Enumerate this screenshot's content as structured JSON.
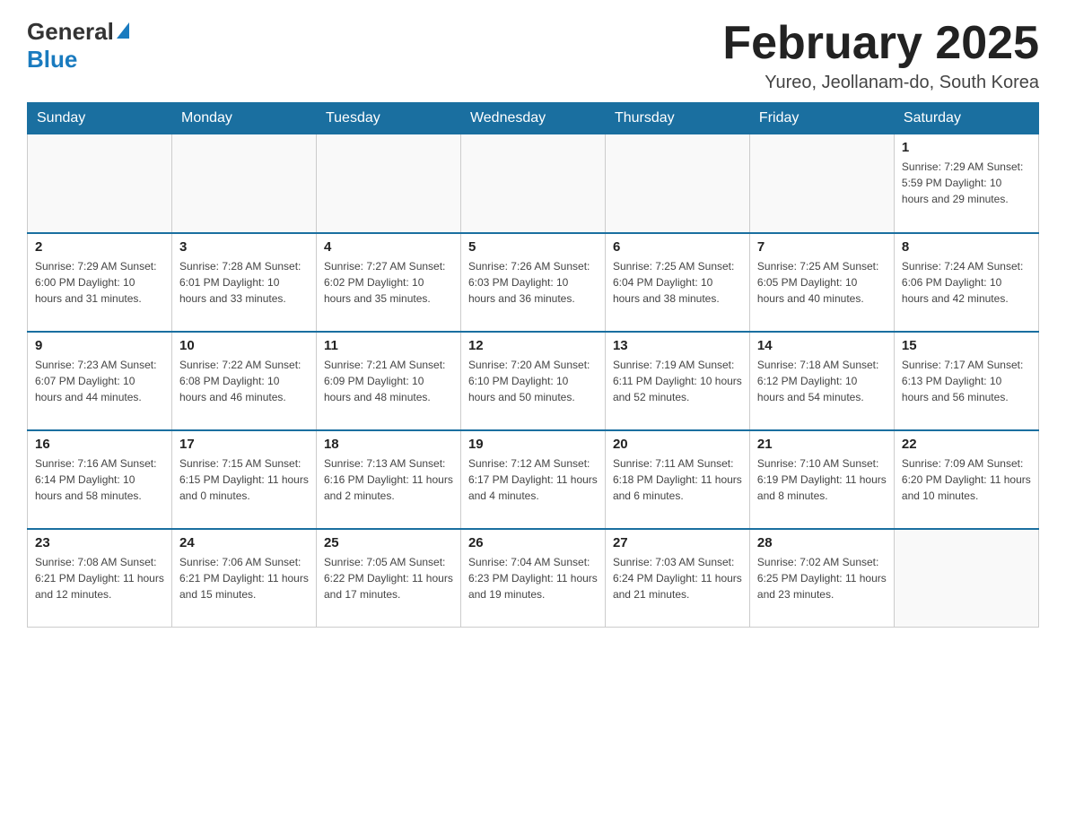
{
  "header": {
    "logo_general": "General",
    "logo_blue": "Blue",
    "month_title": "February 2025",
    "location": "Yureo, Jeollanam-do, South Korea"
  },
  "weekdays": [
    "Sunday",
    "Monday",
    "Tuesday",
    "Wednesday",
    "Thursday",
    "Friday",
    "Saturday"
  ],
  "weeks": [
    [
      {
        "day": "",
        "info": ""
      },
      {
        "day": "",
        "info": ""
      },
      {
        "day": "",
        "info": ""
      },
      {
        "day": "",
        "info": ""
      },
      {
        "day": "",
        "info": ""
      },
      {
        "day": "",
        "info": ""
      },
      {
        "day": "1",
        "info": "Sunrise: 7:29 AM\nSunset: 5:59 PM\nDaylight: 10 hours\nand 29 minutes."
      }
    ],
    [
      {
        "day": "2",
        "info": "Sunrise: 7:29 AM\nSunset: 6:00 PM\nDaylight: 10 hours\nand 31 minutes."
      },
      {
        "day": "3",
        "info": "Sunrise: 7:28 AM\nSunset: 6:01 PM\nDaylight: 10 hours\nand 33 minutes."
      },
      {
        "day": "4",
        "info": "Sunrise: 7:27 AM\nSunset: 6:02 PM\nDaylight: 10 hours\nand 35 minutes."
      },
      {
        "day": "5",
        "info": "Sunrise: 7:26 AM\nSunset: 6:03 PM\nDaylight: 10 hours\nand 36 minutes."
      },
      {
        "day": "6",
        "info": "Sunrise: 7:25 AM\nSunset: 6:04 PM\nDaylight: 10 hours\nand 38 minutes."
      },
      {
        "day": "7",
        "info": "Sunrise: 7:25 AM\nSunset: 6:05 PM\nDaylight: 10 hours\nand 40 minutes."
      },
      {
        "day": "8",
        "info": "Sunrise: 7:24 AM\nSunset: 6:06 PM\nDaylight: 10 hours\nand 42 minutes."
      }
    ],
    [
      {
        "day": "9",
        "info": "Sunrise: 7:23 AM\nSunset: 6:07 PM\nDaylight: 10 hours\nand 44 minutes."
      },
      {
        "day": "10",
        "info": "Sunrise: 7:22 AM\nSunset: 6:08 PM\nDaylight: 10 hours\nand 46 minutes."
      },
      {
        "day": "11",
        "info": "Sunrise: 7:21 AM\nSunset: 6:09 PM\nDaylight: 10 hours\nand 48 minutes."
      },
      {
        "day": "12",
        "info": "Sunrise: 7:20 AM\nSunset: 6:10 PM\nDaylight: 10 hours\nand 50 minutes."
      },
      {
        "day": "13",
        "info": "Sunrise: 7:19 AM\nSunset: 6:11 PM\nDaylight: 10 hours\nand 52 minutes."
      },
      {
        "day": "14",
        "info": "Sunrise: 7:18 AM\nSunset: 6:12 PM\nDaylight: 10 hours\nand 54 minutes."
      },
      {
        "day": "15",
        "info": "Sunrise: 7:17 AM\nSunset: 6:13 PM\nDaylight: 10 hours\nand 56 minutes."
      }
    ],
    [
      {
        "day": "16",
        "info": "Sunrise: 7:16 AM\nSunset: 6:14 PM\nDaylight: 10 hours\nand 58 minutes."
      },
      {
        "day": "17",
        "info": "Sunrise: 7:15 AM\nSunset: 6:15 PM\nDaylight: 11 hours\nand 0 minutes."
      },
      {
        "day": "18",
        "info": "Sunrise: 7:13 AM\nSunset: 6:16 PM\nDaylight: 11 hours\nand 2 minutes."
      },
      {
        "day": "19",
        "info": "Sunrise: 7:12 AM\nSunset: 6:17 PM\nDaylight: 11 hours\nand 4 minutes."
      },
      {
        "day": "20",
        "info": "Sunrise: 7:11 AM\nSunset: 6:18 PM\nDaylight: 11 hours\nand 6 minutes."
      },
      {
        "day": "21",
        "info": "Sunrise: 7:10 AM\nSunset: 6:19 PM\nDaylight: 11 hours\nand 8 minutes."
      },
      {
        "day": "22",
        "info": "Sunrise: 7:09 AM\nSunset: 6:20 PM\nDaylight: 11 hours\nand 10 minutes."
      }
    ],
    [
      {
        "day": "23",
        "info": "Sunrise: 7:08 AM\nSunset: 6:21 PM\nDaylight: 11 hours\nand 12 minutes."
      },
      {
        "day": "24",
        "info": "Sunrise: 7:06 AM\nSunset: 6:21 PM\nDaylight: 11 hours\nand 15 minutes."
      },
      {
        "day": "25",
        "info": "Sunrise: 7:05 AM\nSunset: 6:22 PM\nDaylight: 11 hours\nand 17 minutes."
      },
      {
        "day": "26",
        "info": "Sunrise: 7:04 AM\nSunset: 6:23 PM\nDaylight: 11 hours\nand 19 minutes."
      },
      {
        "day": "27",
        "info": "Sunrise: 7:03 AM\nSunset: 6:24 PM\nDaylight: 11 hours\nand 21 minutes."
      },
      {
        "day": "28",
        "info": "Sunrise: 7:02 AM\nSunset: 6:25 PM\nDaylight: 11 hours\nand 23 minutes."
      },
      {
        "day": "",
        "info": ""
      }
    ]
  ]
}
